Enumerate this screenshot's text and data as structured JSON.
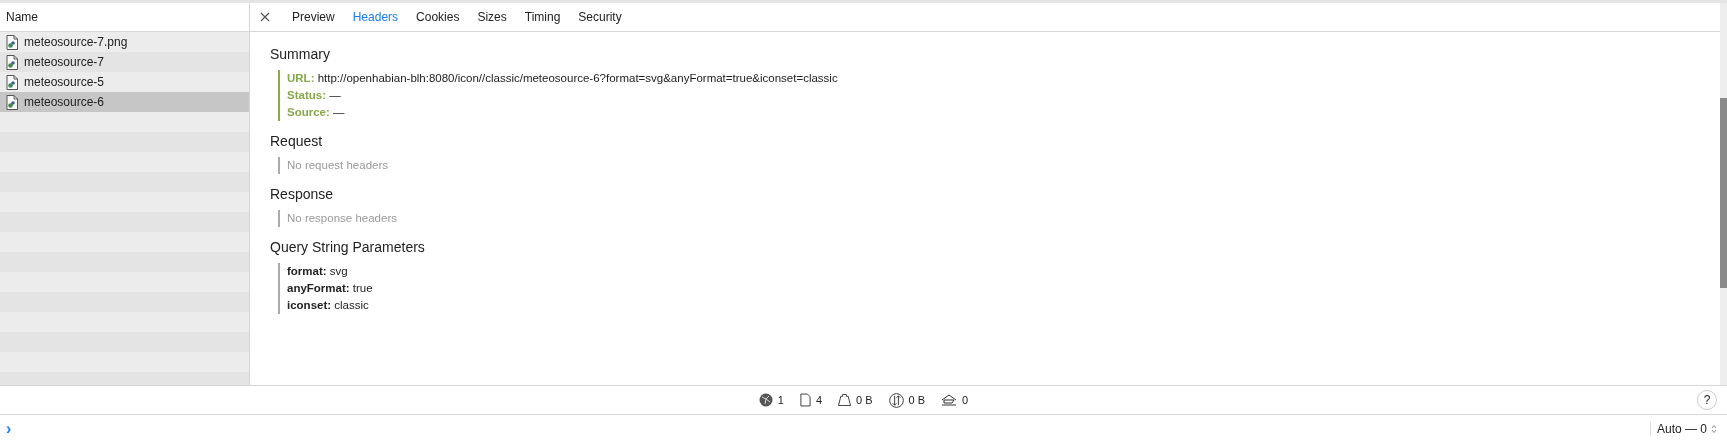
{
  "list": {
    "column": "Name",
    "items": [
      {
        "name": "meteosource-7.png",
        "selected": false
      },
      {
        "name": "meteosource-7",
        "selected": false
      },
      {
        "name": "meteosource-5",
        "selected": false
      },
      {
        "name": "meteosource-6",
        "selected": true
      }
    ]
  },
  "tabs": [
    {
      "label": "Preview",
      "selected": false
    },
    {
      "label": "Headers",
      "selected": true
    },
    {
      "label": "Cookies",
      "selected": false
    },
    {
      "label": "Sizes",
      "selected": false
    },
    {
      "label": "Timing",
      "selected": false
    },
    {
      "label": "Security",
      "selected": false
    }
  ],
  "sections": [
    {
      "title": "Summary",
      "kind": "summary",
      "rows": [
        {
          "key": "URL:",
          "value": "http://openhabian-blh:8080/icon//classic/meteosource-6?format=svg&anyFormat=true&iconset=classic"
        },
        {
          "key": "Status:",
          "value": "—"
        },
        {
          "key": "Source:",
          "value": "—"
        }
      ]
    },
    {
      "title": "Request",
      "kind": "empty",
      "message": "No request headers"
    },
    {
      "title": "Response",
      "kind": "empty",
      "message": "No response headers"
    },
    {
      "title": "Query String Parameters",
      "kind": "params",
      "rows": [
        {
          "key": "format:",
          "value": "svg"
        },
        {
          "key": "anyFormat:",
          "value": "true"
        },
        {
          "key": "iconset:",
          "value": "classic"
        }
      ]
    }
  ],
  "stats": [
    {
      "kind": "globe",
      "value": "1"
    },
    {
      "kind": "document",
      "value": "4"
    },
    {
      "kind": "weight",
      "value": "0 B"
    },
    {
      "kind": "transfer",
      "value": "0 B"
    },
    {
      "kind": "resources",
      "value": "0"
    }
  ],
  "help": "?",
  "prompt": "›",
  "context": "Auto — 0"
}
